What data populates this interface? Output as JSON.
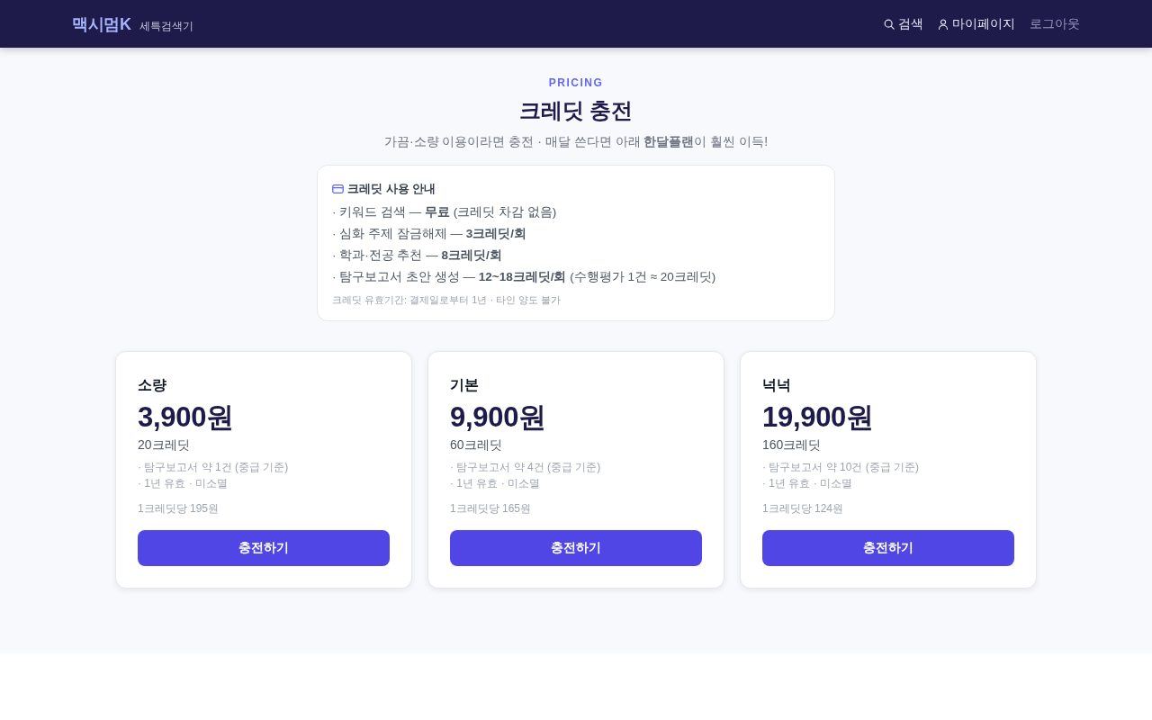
{
  "header": {
    "logo": "맥시멈K",
    "tagline": "세특검색기",
    "nav": [
      {
        "label": "검색",
        "kind": "search"
      },
      {
        "label": "마이페이지",
        "kind": "user"
      },
      {
        "label": "로그아웃",
        "kind": "logout"
      }
    ]
  },
  "hero": {
    "eyebrow": "PRICING",
    "title": "크레딧 충전",
    "subtitle": "가끔·소량 이용이라면 충전 · 매달 쓴다면 아래 **한달플랜**이 훨씬 이득!"
  },
  "usage_guide": {
    "title": "크레딧 사용 안내",
    "items": [
      "· 키워드 검색 — **무료** (크레딧 차감 없음)",
      "· 심화 주제 잠금해제 — **3크레딧/회**",
      "· 학과·전공 추천 — **8크레딧/회**",
      "· 탐구보고서 초안 생성 — **12~18크레딧/회** (수행평가 1건 ≈ 20크레딧)"
    ],
    "note": "크레딧 유효기간: 결제일로부터 1년 · 타인 양도 불가"
  },
  "packages": [
    {
      "name": "소량",
      "price": "3,900원",
      "credits": "20크레딧",
      "features": [
        "· 탐구보고서 약 1건 (중급 기준)",
        "· 1년 유효 · 미소멸"
      ],
      "unit_price": "1크레딧당 195원",
      "button": "충전하기"
    },
    {
      "name": "기본",
      "price": "9,900원",
      "credits": "60크레딧",
      "features": [
        "· 탐구보고서 약 4건 (중급 기준)",
        "· 1년 유효 · 미소멸"
      ],
      "unit_price": "1크레딧당 165원",
      "button": "충전하기"
    },
    {
      "name": "넉넉",
      "price": "19,900원",
      "credits": "160크레딧",
      "features": [
        "· 탐구보고서 약 10건 (중급 기준)",
        "· 1년 유효 · 미소멸"
      ],
      "unit_price": "1크레딧당 124원",
      "button": "충전하기"
    }
  ]
}
